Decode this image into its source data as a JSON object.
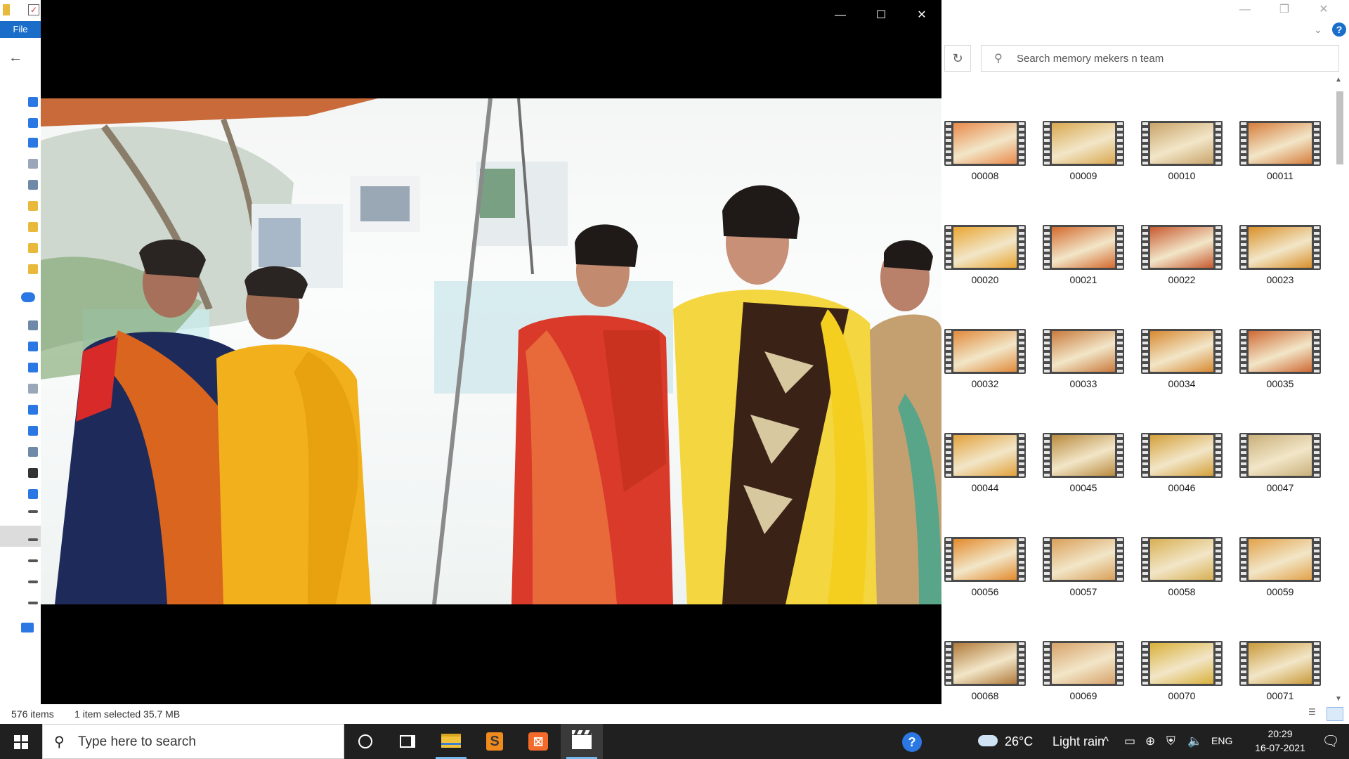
{
  "explorer": {
    "file_tab": "File",
    "search_placeholder": "Search memory mekers n team",
    "status": {
      "item_count": "576 items",
      "selection": "1 item selected  35.7 MB"
    },
    "thumbnails": [
      {
        "label": "00008",
        "color": "#e98a4b"
      },
      {
        "label": "00009",
        "color": "#d9a850"
      },
      {
        "label": "00010",
        "color": "#c9a46b"
      },
      {
        "label": "00011",
        "color": "#d67d3c"
      },
      {
        "label": "00020",
        "color": "#e9a532"
      },
      {
        "label": "00021",
        "color": "#d46a2e"
      },
      {
        "label": "00022",
        "color": "#c85a30"
      },
      {
        "label": "00023",
        "color": "#d9902a"
      },
      {
        "label": "00032",
        "color": "#e08a3a"
      },
      {
        "label": "00033",
        "color": "#c97a3c"
      },
      {
        "label": "00034",
        "color": "#d88a32"
      },
      {
        "label": "00035",
        "color": "#cf6a34"
      },
      {
        "label": "00044",
        "color": "#e2a13c"
      },
      {
        "label": "00045",
        "color": "#b98a3e"
      },
      {
        "label": "00046",
        "color": "#d4a03a"
      },
      {
        "label": "00047",
        "color": "#c9b07a"
      },
      {
        "label": "00056",
        "color": "#e38a2c"
      },
      {
        "label": "00057",
        "color": "#d9a05a"
      },
      {
        "label": "00058",
        "color": "#d8b054"
      },
      {
        "label": "00059",
        "color": "#e2a24a"
      },
      {
        "label": "00068",
        "color": "#b07a3a"
      },
      {
        "label": "00069",
        "color": "#d7a26a"
      },
      {
        "label": "00070",
        "color": "#d9b03a"
      },
      {
        "label": "00071",
        "color": "#c99a3a"
      }
    ]
  },
  "player": {
    "minimize_glyph": "—",
    "maximize_glyph": "☐",
    "close_glyph": "✕"
  },
  "taskbar": {
    "search_placeholder": "Type here to search",
    "weather_temp": "26°C",
    "weather_condition": "Light rain",
    "language": "ENG",
    "time": "20:29",
    "date": "16-07-2021",
    "icons": {
      "start": "windows-logo-icon",
      "cortana": "cortana-ring-icon",
      "task_view": "task-view-icon",
      "explorer": "file-explorer-icon",
      "sublime": "sublime-text-icon",
      "xampp": "xampp-icon",
      "video": "movies-tv-icon"
    }
  },
  "colors": {
    "accent": "#1a6ec9",
    "taskbar_bg": "#202020",
    "active_indicator": "#76b9ed"
  }
}
